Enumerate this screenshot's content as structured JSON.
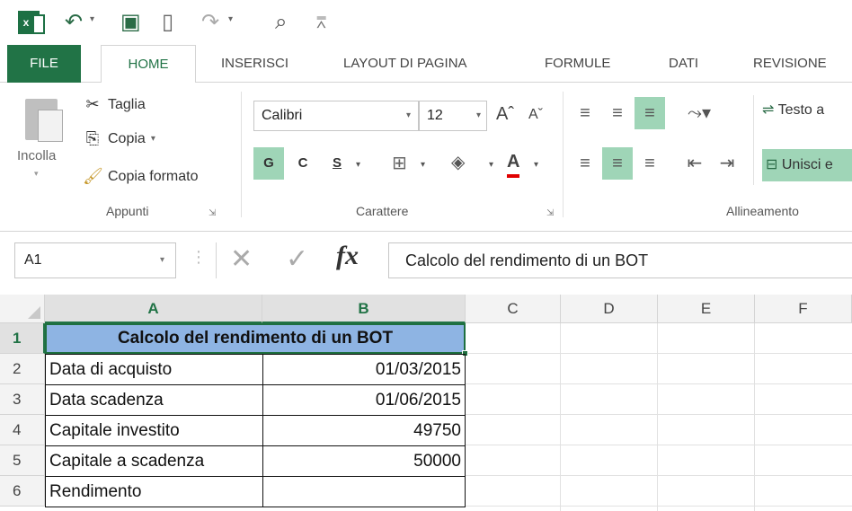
{
  "qat": {
    "logo_text": "x▐",
    "undo_glyph": "↶",
    "save_glyph": "▣",
    "new_glyph": "▯",
    "redo_glyph": "↷",
    "preview_glyph": "⌕",
    "customize_glyph": "⩞",
    "dropdown_glyph": "▾"
  },
  "tabs": [
    "FILE",
    "HOME",
    "INSERISCI",
    "LAYOUT DI PAGINA",
    "FORMULE",
    "DATI",
    "REVISIONE"
  ],
  "active_tab": "HOME",
  "ribbon": {
    "clipboard": {
      "paste_label": "Incolla",
      "cut_label": "Taglia",
      "copy_label": "Copia",
      "format_painter_label": "Copia formato",
      "group_label": "Appunti"
    },
    "font": {
      "font_name": "Calibri",
      "font_size": "12",
      "bold_label": "G",
      "italic_label": "C",
      "underline_label": "S",
      "font_color_label": "A",
      "grow_label": "Aˆ",
      "shrink_label": "Aˇ",
      "group_label": "Carattere"
    },
    "alignment": {
      "wrap_label": "Testo a",
      "merge_label": "Unisci e",
      "group_label": "Allineamento"
    }
  },
  "formula_bar": {
    "name_box": "A1",
    "fx_label": "fx",
    "cancel_glyph": "✕",
    "enter_glyph": "✓",
    "content": "Calcolo del rendimento di un BOT"
  },
  "columns": [
    "A",
    "B",
    "C",
    "D",
    "E",
    "F"
  ],
  "rows": [
    "1",
    "2",
    "3",
    "4",
    "5",
    "6"
  ],
  "sheet": {
    "title": "Calcolo del rendimento di un BOT",
    "data": [
      {
        "label": "Data di acquisto",
        "value": "01/03/2015"
      },
      {
        "label": "Data scadenza",
        "value": "01/06/2015"
      },
      {
        "label": "Capitale investito",
        "value": "49750"
      },
      {
        "label": "Capitale a scadenza",
        "value": "50000"
      },
      {
        "label": "Rendimento",
        "value": ""
      }
    ]
  },
  "colors": {
    "excel_green": "#217346",
    "title_fill": "#8eb4e3",
    "selection_highlight": "#9fd5b7"
  }
}
